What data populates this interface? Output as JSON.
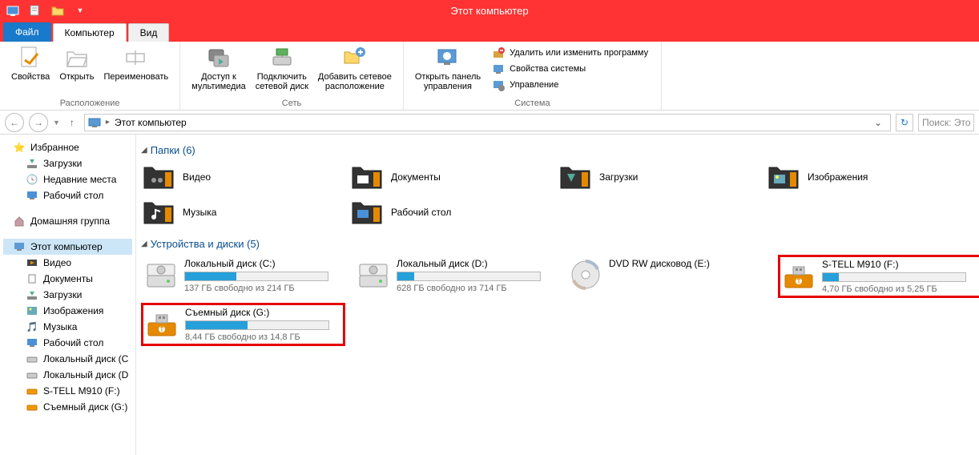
{
  "window_title": "Этот компьютер",
  "tabs": {
    "file": "Файл",
    "computer": "Компьютер",
    "view": "Вид"
  },
  "ribbon": {
    "location_group": "Расположение",
    "properties": "Свойства",
    "open": "Открыть",
    "rename": "Переименовать",
    "network_group": "Сеть",
    "media_access_l1": "Доступ к",
    "media_access_l2": "мультимедиа",
    "map_drive_l1": "Подключить",
    "map_drive_l2": "сетевой диск",
    "add_net_l1": "Добавить сетевое",
    "add_net_l2": "расположение",
    "system_group": "Система",
    "open_panel_l1": "Открыть панель",
    "open_panel_l2": "управления",
    "uninstall": "Удалить или изменить программу",
    "sys_props": "Свойства системы",
    "manage": "Управление"
  },
  "address": {
    "location": "Этот компьютер"
  },
  "search_placeholder": "Поиск: Это",
  "sidebar": {
    "favorites": "Избранное",
    "downloads": "Загрузки",
    "recent": "Недавние места",
    "desktop": "Рабочий стол",
    "homegroup": "Домашняя группа",
    "this_pc": "Этот компьютер",
    "videos": "Видео",
    "documents": "Документы",
    "downloads2": "Загрузки",
    "pictures": "Изображения",
    "music": "Музыка",
    "desktop2": "Рабочий стол",
    "local_c": "Локальный диск (C",
    "local_d": "Локальный диск (D",
    "stell": "S-TELL M910 (F:)",
    "removable_g": "Съемный диск (G:)"
  },
  "sections": {
    "folders_label": "Папки (6)",
    "drives_label": "Устройства и диски (5)"
  },
  "folders": [
    {
      "name": "Видео"
    },
    {
      "name": "Документы"
    },
    {
      "name": "Загрузки"
    },
    {
      "name": "Изображения"
    },
    {
      "name": "Музыка"
    },
    {
      "name": "Рабочий стол"
    }
  ],
  "drives": [
    {
      "name": "Локальный диск (C:)",
      "free": "137 ГБ свободно из 214 ГБ",
      "fill": 36,
      "type": "hdd",
      "hl": false
    },
    {
      "name": "Локальный диск (D:)",
      "free": "628 ГБ свободно из 714 ГБ",
      "fill": 12,
      "type": "hdd",
      "hl": false
    },
    {
      "name": "DVD RW дисковод (E:)",
      "free": "",
      "fill": -1,
      "type": "dvd",
      "hl": false
    },
    {
      "name": "S-TELL M910 (F:)",
      "free": "4,70 ГБ свободно из 5,25 ГБ",
      "fill": 11,
      "type": "usb",
      "hl": true
    },
    {
      "name": "Съемный диск (G:)",
      "free": "8,44 ГБ свободно из 14,8 ГБ",
      "fill": 43,
      "type": "usb",
      "hl": true
    }
  ]
}
